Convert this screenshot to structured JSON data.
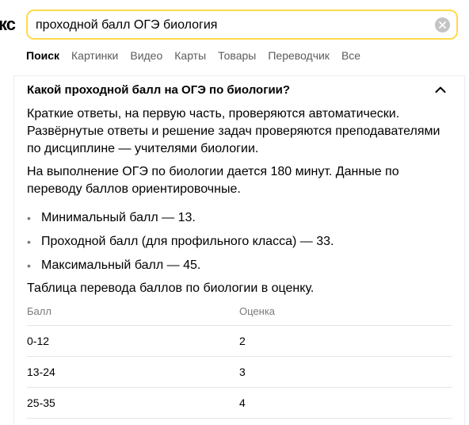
{
  "header": {
    "logo_fragment": "кс",
    "search_value": "проходной балл ОГЭ биология"
  },
  "tabs": [
    "Поиск",
    "Картинки",
    "Видео",
    "Карты",
    "Товары",
    "Переводчик",
    "Все"
  ],
  "answer": {
    "question": "Какой проходной балл на ОГЭ по биологии?",
    "paragraph1": "Краткие ответы, на первую часть, проверяются автоматически. Развёрнутые ответы и решение задач проверяются преподавателями по дисциплине — учителями биологии.",
    "paragraph2": "На выполнение ОГЭ по биологии дается 180 минут. Данные по переводу баллов ориентировочные.",
    "bullets": [
      "Минимальный балл — 13.",
      "Проходной балл (для профильного класса) — 33.",
      "Максимальный балл — 45."
    ],
    "table_caption": "Таблица перевода баллов по биологии в оценку.",
    "table": {
      "headers": [
        "Балл",
        "Оценка"
      ],
      "rows": [
        [
          "0-12",
          "2"
        ],
        [
          "13-24",
          "3"
        ],
        [
          "25-35",
          "4"
        ]
      ]
    }
  },
  "colors": {
    "search_border": "#ffdb4d",
    "muted_text": "#5c5c5c"
  }
}
